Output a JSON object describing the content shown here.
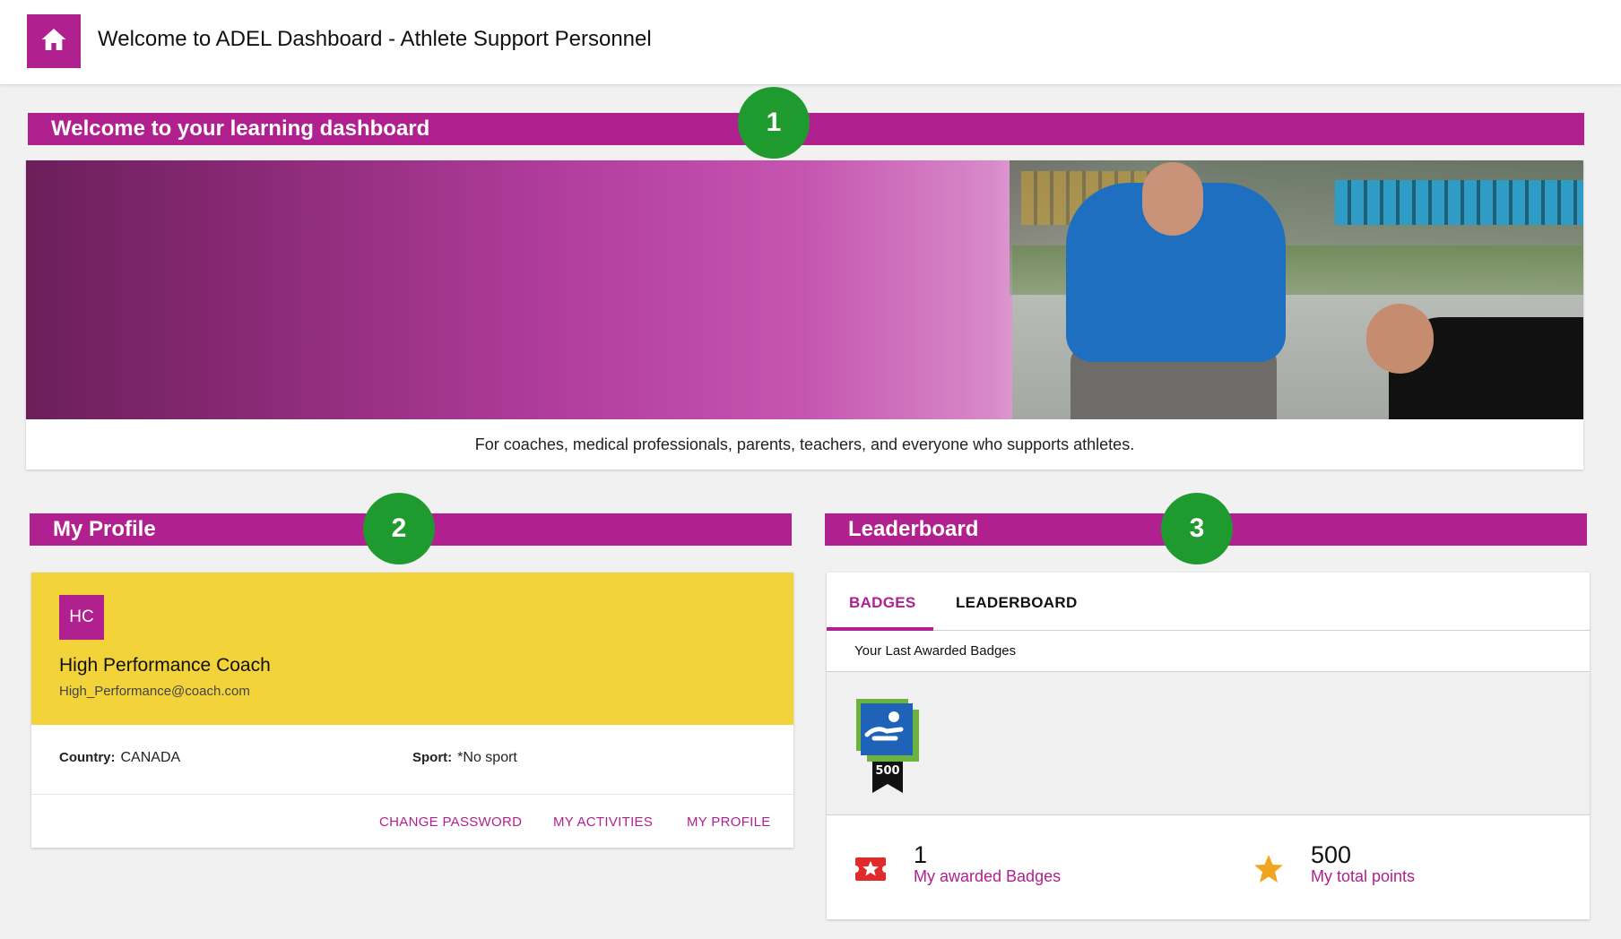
{
  "header": {
    "title": "Welcome to ADEL Dashboard",
    "subtitle": " - Athlete Support Personnel",
    "home_icon": "home-icon"
  },
  "welcome": {
    "section_title": "Welcome to your learning dashboard",
    "marker": "1",
    "caption": "For coaches, medical professionals, parents, teachers, and everyone who supports athletes."
  },
  "profile": {
    "section_title": "My Profile",
    "marker": "2",
    "initials": "HC",
    "name": "High Performance Coach",
    "email": "High_Performance@coach.com",
    "country_label": "Country:",
    "country": "CANADA",
    "sport_label": "Sport:",
    "sport": "*No sport",
    "actions": {
      "change_password": "CHANGE PASSWORD",
      "my_activities": "MY ACTIVITIES",
      "my_profile": "MY PROFILE"
    }
  },
  "leaderboard": {
    "section_title": "Leaderboard",
    "marker": "3",
    "tabs": {
      "badges": "BADGES",
      "leaderboard": "LEADERBOARD"
    },
    "active_tab": "BADGES",
    "subtitle": "Your Last Awarded Badges",
    "badge": {
      "icon": "situp-badge-icon",
      "value": "500"
    },
    "stats": {
      "badges_count": "1",
      "badges_label": "My awarded Badges",
      "points_count": "500",
      "points_label": "My total points"
    }
  },
  "colors": {
    "brand": "#b0208f",
    "marker": "#1f9a2e",
    "profile_card": "#f2d33a",
    "star": "#f2a41f",
    "badge_red": "#e02b2b"
  }
}
